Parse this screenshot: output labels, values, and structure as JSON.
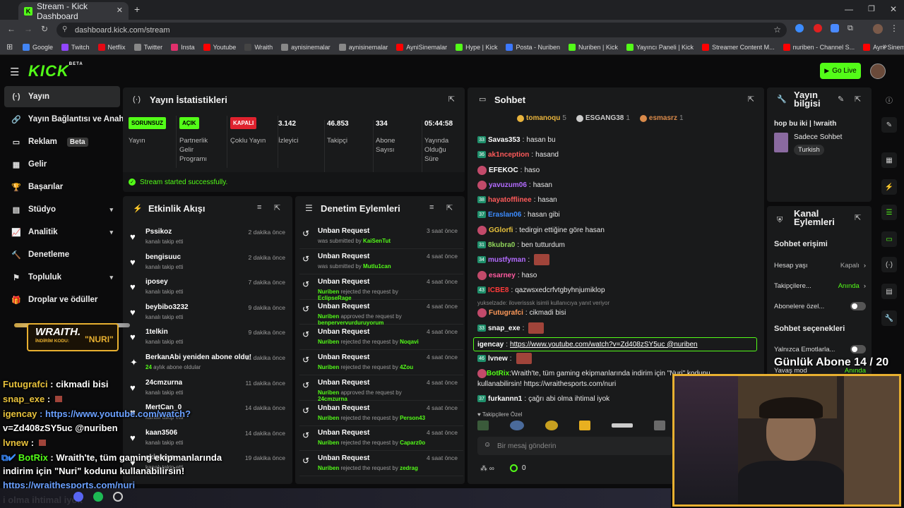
{
  "browser": {
    "tab_title": "Stream - Kick Dashboard",
    "url": "dashboard.kick.com/stream",
    "bookmarks": [
      "Google",
      "Twitch",
      "Netflix",
      "Twitter",
      "Insta",
      "Youtube",
      "Wraith",
      "aynisinemalar",
      "aynisinemalar",
      "AyniSinemalar",
      "Hype | Kick",
      "Posta - Nuriben",
      "Nuriben | Kick",
      "Yayıncı Paneli | Kick",
      "Streamer Content M...",
      "nuriben - Channel S...",
      "Aynı Sinemalar - Ça..."
    ],
    "bookmark_colors": [
      "#4285f4",
      "#9146ff",
      "#e50914",
      "#888888",
      "#e1306c",
      "#ff0000",
      "#444444",
      "#888888",
      "#888888",
      "#ff0000",
      "#53fc18",
      "#3c78ff",
      "#53fc18",
      "#53fc18",
      "#ff0000",
      "#ff0000",
      "#ff0000"
    ]
  },
  "header": {
    "logo": "KICK",
    "logo_tag": "BETA",
    "go_live": "Go Live"
  },
  "sidebar": {
    "items": [
      {
        "label": "Yayın",
        "icon": "broadcast-icon"
      },
      {
        "label": "Yayın Bağlantısı ve Anahtar",
        "icon": "link-icon"
      },
      {
        "label": "Reklam",
        "icon": "ad-icon",
        "badge": "Beta"
      },
      {
        "label": "Gelir",
        "icon": "revenue-icon"
      },
      {
        "label": "Başarılar",
        "icon": "trophy-icon"
      },
      {
        "label": "Stüdyo",
        "icon": "studio-icon"
      },
      {
        "label": "Analitik",
        "icon": "analytics-icon"
      },
      {
        "label": "Denetleme",
        "icon": "moderation-icon"
      },
      {
        "label": "Topluluk",
        "icon": "community-icon"
      },
      {
        "label": "Droplar ve ödüller",
        "icon": "drops-icon"
      }
    ]
  },
  "stats": {
    "title": "Yayın İstatistikleri",
    "badges": [
      {
        "text": "SORUNSUZ",
        "label": "Yayın",
        "bg": "#53fc18",
        "fg": "#000000"
      },
      {
        "text": "AÇIK",
        "label": "Partnerlik Gelir Programı",
        "bg": "#53fc18",
        "fg": "#000000"
      },
      {
        "text": "KAPALI",
        "label": "Çoklu Yayın",
        "bg": "#e0222e",
        "fg": "#ffffff"
      }
    ],
    "values": [
      {
        "value": "3.142",
        "label": "İzleyici"
      },
      {
        "value": "46.853",
        "label": "Takipçi"
      },
      {
        "value": "334",
        "label": "Abone Sayısı"
      },
      {
        "value": "05:44:58",
        "label": "Yayında Olduğu Süre"
      }
    ],
    "status": "Stream started successfully."
  },
  "activity": {
    "title": "Etkinlik Akışı",
    "rows": [
      {
        "name": "Pssikoz",
        "sub": "kanalı takip etti",
        "time": "2 dakika önce",
        "icon": "heart-icon"
      },
      {
        "name": "bengisuuc",
        "sub": "kanalı takip etti",
        "time": "2 dakika önce",
        "icon": "heart-icon"
      },
      {
        "name": "iposey",
        "sub": "kanalı takip etti",
        "time": "7 dakika önce",
        "icon": "heart-icon"
      },
      {
        "name": "beybibo3232",
        "sub": "kanalı takip etti",
        "time": "9 dakika önce",
        "icon": "heart-icon"
      },
      {
        "name": "1telkin",
        "sub": "kanalı takip etti",
        "time": "9 dakika önce",
        "icon": "heart-icon"
      },
      {
        "name": "BerkanAbi yeniden abone oldu!",
        "sub_green": "24",
        "sub": "aylık abone oldular",
        "time": "11 dakika önce",
        "icon": "sparkle-icon"
      },
      {
        "name": "24cmzurna",
        "sub": "kanalı takip etti",
        "time": "11 dakika önce",
        "icon": "heart-icon"
      },
      {
        "name": "MertCan_0",
        "sub": "kanalı takip etti",
        "time": "14 dakika önce",
        "icon": "heart-icon"
      },
      {
        "name": "kaan3506",
        "sub": "kanalı takip etti",
        "time": "14 dakika önce",
        "icon": "heart-icon"
      },
      {
        "name": "ekipman",
        "sub": "kanalı takip etti",
        "time": "19 dakika önce",
        "icon": "heart-icon"
      }
    ]
  },
  "moderation": {
    "title": "Denetim Eylemleri",
    "rows": [
      {
        "title": "Unban Request",
        "time": "3 saat önce",
        "pre": "",
        "user1": "",
        "mid": "was submitted by ",
        "user2": "KaiSenTut"
      },
      {
        "title": "Unban Request",
        "time": "4 saat önce",
        "pre": "",
        "user1": "",
        "mid": "was submitted by ",
        "user2": "Mutlu1can"
      },
      {
        "title": "Unban Request",
        "time": "4 saat önce",
        "user1": "Nuriben",
        "mid": " rejected the request by ",
        "user2": "EclipseRage"
      },
      {
        "title": "Unban Request",
        "time": "4 saat önce",
        "user1": "Nuriben",
        "mid": " approved the request by ",
        "user2": "benpervervurduruyorum"
      },
      {
        "title": "Unban Request",
        "time": "4 saat önce",
        "user1": "Nuriben",
        "mid": " rejected the request by ",
        "user2": "Noqavi"
      },
      {
        "title": "Unban Request",
        "time": "4 saat önce",
        "user1": "Nuriben",
        "mid": " rejected the request by ",
        "user2": "4Zou"
      },
      {
        "title": "Unban Request",
        "time": "4 saat önce",
        "user1": "Nuriben",
        "mid": " approved the request by ",
        "user2": "24cmzurna"
      },
      {
        "title": "Unban Request",
        "time": "4 saat önce",
        "user1": "Nuriben",
        "mid": " rejected the request by ",
        "user2": "Person43"
      },
      {
        "title": "Unban Request",
        "time": "4 saat önce",
        "user1": "Nuriben",
        "mid": " rejected the request by ",
        "user2": "Caparz0o"
      },
      {
        "title": "Unban Request",
        "time": "4 saat önce",
        "user1": "Nuriben",
        "mid": " rejected the request by ",
        "user2": "zedrag"
      }
    ]
  },
  "chat": {
    "title": "Sohbet",
    "top_gifters": [
      {
        "name": "tomanoqu",
        "count": "5",
        "color": "#e8b33c"
      },
      {
        "name": "ESGANG38",
        "count": "1",
        "color": "#cccccc"
      },
      {
        "name": "esmasrz",
        "count": "1",
        "color": "#d98a4a"
      }
    ],
    "messages": [
      {
        "lvl": "33",
        "user": "Savas353",
        "color": "#ffffff",
        "text": "hasan bu"
      },
      {
        "lvl": "36",
        "user": "ak1nception",
        "color": "#ff5a5a",
        "text": "hasand"
      },
      {
        "lvl": "",
        "user": "EFEKOC",
        "color": "#ffffff",
        "text": "haso"
      },
      {
        "lvl": "",
        "user": "yavuzum06",
        "color": "#b36bff",
        "text": "hasan"
      },
      {
        "lvl": "38",
        "user": "hayatofflinee",
        "color": "#ff5a5a",
        "text": "hasan"
      },
      {
        "lvl": "37",
        "user": "Eraslan06",
        "color": "#3c8cff",
        "text": "hasan gibi"
      },
      {
        "lvl": "",
        "user": "GGlorfi",
        "color": "#e8c23c",
        "text": "tedirgin ettiğine göre hasan"
      },
      {
        "lvl": "31",
        "user": "8kubra0",
        "color": "#8fd35a",
        "text": "ben tutturdum"
      },
      {
        "lvl": "34",
        "user": "mustfyman",
        "color": "#b36bff",
        "text": ""
      },
      {
        "lvl": "",
        "user": "esarney",
        "color": "#ff5aa0",
        "text": "haso"
      },
      {
        "lvl": "43",
        "user": "ICBE8",
        "color": "#ff3a3a",
        "text": "qazwsxedcrfvtgbyhnjumiklop"
      },
      {
        "lvl": "",
        "user": "Futugrafci",
        "color": "#ff9a5a",
        "text": "cikmadi bisi"
      },
      {
        "lvl": "33",
        "user": "snap_exe",
        "color": "#ffffff",
        "text": ""
      },
      {
        "lvl": "",
        "user": "igencay",
        "color": "#ffffff",
        "text": "https://www.youtube.com/watch?v=Zd408zSY5uc @nuriben"
      },
      {
        "lvl": "46",
        "user": "lvnew",
        "color": "#ffffff",
        "text": ""
      },
      {
        "lvl": "",
        "user": "BotRix",
        "color": "#53fc18",
        "text": "Wraith'te, tüm gaming ekipmanlarında indirim için \"Nuri\" kodunu kullanabilirsin! https://wraithesports.com/nuri"
      },
      {
        "lvl": "37",
        "user": "furkannn1",
        "color": "#ffffff",
        "text": "çağrı abi olma ihtimal iyok"
      }
    ],
    "reply_note": "yukselzade: iloverisssk isimli kullanıcıya yanıt veriyor",
    "emote_section": "Takipçilere Özel",
    "input_placeholder": "Bir mesaj gönderin",
    "points": "0"
  },
  "stream_info": {
    "title": "Yayın bilgisi",
    "stream_title": "hop bu iki | !wraith",
    "category": "Sadece Sohbet",
    "tag": "Turkish"
  },
  "channel_actions": {
    "title": "Kanal Eylemleri",
    "chat_access": "Sohbet erişimi",
    "rows": [
      {
        "label": "Hesap yaşı",
        "value": "Kapalı"
      },
      {
        "label": "Takipçilere...",
        "value": "Anında"
      },
      {
        "label": "Abonelere özel...",
        "value": ""
      }
    ],
    "chat_options": "Sohbet seçenekleri",
    "rows2": [
      {
        "label": "Yalnızca Emotlarla...",
        "value": ""
      },
      {
        "label": "Yavaş mod",
        "value": "Anında"
      }
    ]
  },
  "overlay": {
    "sub_goal": "Günlük Abone 14 / 20",
    "wraith_brand": "WRAITH.",
    "wraith_code_label": "İNDİRİM KODU:",
    "wraith_code": "\"NURI\"",
    "chat": [
      {
        "user": "Futugrafci",
        "color": "#e8c23c",
        "text": " : cikmadi bisi"
      },
      {
        "user": "snap_exe",
        "color": "#e8c23c",
        "text": " : "
      },
      {
        "user": "igencay",
        "color": "#e8c23c",
        "text": " : https://www.youtube.com/watch?"
      },
      {
        "user": "",
        "color": "#ffffff",
        "text": "v=Zd408zSY5uc @nuriben"
      },
      {
        "user": "lvnew",
        "color": "#e8c23c",
        "text": " : "
      },
      {
        "user": "BotRix",
        "color": "#53fc18",
        "text": " : Wraith'te, tüm gaming ekipmanlarında"
      },
      {
        "user": "",
        "color": "#ffffff",
        "text": "indirim için \"Nuri\" kodunu kullanabilirsin!"
      },
      {
        "user": "",
        "color": "#6aa0ff",
        "text": "https://wraithesports.com/nuri"
      },
      {
        "user": "",
        "color": "#ffffff",
        "text": "i olma ihtimal iyok"
      }
    ]
  }
}
